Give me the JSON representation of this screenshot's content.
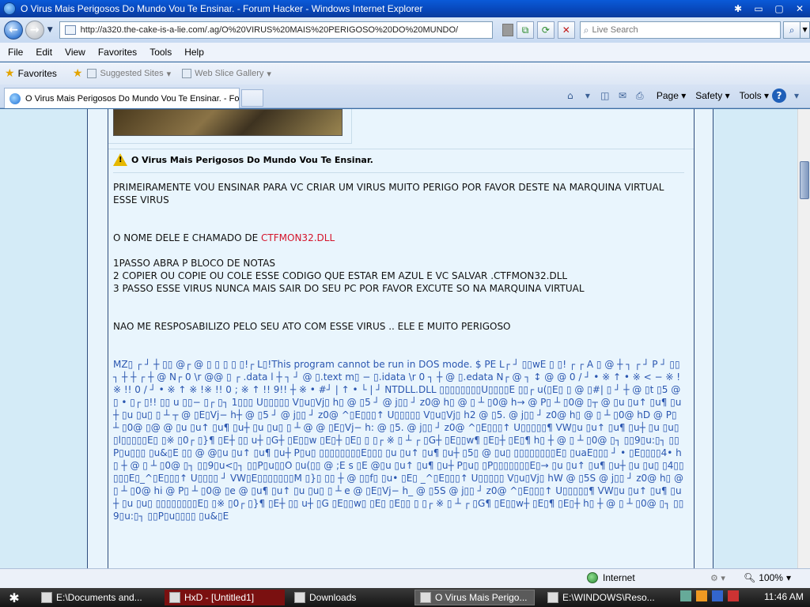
{
  "window": {
    "title": "O Virus Mais Perigosos Do Mundo Vou Te Ensinar. - Forum Hacker - Windows Internet Explorer"
  },
  "address_bar": {
    "url": "http://a320.the-cake-is-a-lie.com/.ag/O%20VIRUS%20MAIS%20PERIGOSO%20DO%20MUNDO/"
  },
  "search": {
    "placeholder": "Live Search"
  },
  "menu": [
    "File",
    "Edit",
    "View",
    "Favorites",
    "Tools",
    "Help"
  ],
  "favorites_bar": {
    "favorites_label": "Favorites",
    "suggested_sites": "Suggested Sites",
    "web_slice_gallery": "Web Slice Gallery"
  },
  "tabs": [
    {
      "label": "O Virus Mais Perigosos Do Mundo Vou Te Ensinar. - Fo..."
    }
  ],
  "command_bar": {
    "page": "Page",
    "safety": "Safety",
    "tools": "Tools"
  },
  "post": {
    "title": "O Virus Mais Perigosos Do Mundo Vou Te Ensinar.",
    "line1": "PRIMEIRAMENTE VOU ENSINAR PARA VC CRIAR UM VIRUS MUITO PERIGO POR FAVOR DESTE NA MARQUINA VIRTUAL ESSE VIRUS",
    "name_prefix": "O NOME DELE E CHAMADO DE ",
    "name_value": "CTFMON32.DLL",
    "step1": "1PASSO ABRA P BLOCO DE NOTAS",
    "step2": "2 COPIER OU COPIE OU COLE ESSE CODIGO QUE ESTAR EM AZUL E VC SALVAR .CTFMON32.DLL",
    "step3": "3 PASSO ESSE VIRUS NUNCA MAIS SAIR DO SEU PC POR FAVOR EXCUTE SO NA MARQUINA VIRTUAL",
    "disclaimer": "NAO ME RESPOSABILIZO PELO SEU ATO COM ESSE VIRUS .. ELE E MUITO PERIGOSO",
    "code": "MZ▯ ┌ ┘ ┼ ▯▯ @┌ @ ▯ ▯ ▯ ▯ ▯!┌ L▯!This program cannot be run in DOS mode. $ PE L┌ ┘ ▯▯wE ▯ ▯! ┌ ┌ A ▯ @ ┼ ┐ ┌ ┘ P ┘ ▯▯ ┐ ┼ ┼ ┌ ┼ @ N┌ 0 \\r @@ ▯ ┌ .data l ┼ ┐ ┘ @ ▯.text m▯ − ▯.idata \\r 0 ┐ ┼ @ ▯.edata N┌ @ ┐ ↕ @ @ 0 / ┘ • ※ ↑ • ※ < − ※ !※ !! 0 / ┘ • ※ ↑ ※ !※ !! 0 ; ※ ↑ !! 9!! ┼ ※ • #┘ | ↑ • └ | ┘ NTDLL.DLL ▯▯▯▯▯▯▯▯U▯▯▯▯E ▯▯┌ u(▯E▯ ▯ @ ▯#| ▯ ┘ ┼ @ ▯t ▯5 @ ▯ • ▯┌ ▯!! ▯▯ u ▯▯− ▯┌ ▯┐ 1▯▯▯ U▯▯▯▯▯ V▯u▯Vj▯ h▯ @ ▯5 ┘ @ j▯▯ ┘ z0@ h▯ @ ▯ ┴ ▯0@ h→ @ P▯ ┴ ▯0@ ▯┬ @ ▯u ▯u↑ ▯u¶ ▯u┼ ▯u ▯u▯ ▯ ┴ ┬ @ ▯E▯Vj− h┼ @ ▯5 ┘ @ j▯▯ ┘ z0@ ^▯E▯▯▯↑ U▯▯▯▯▯ V▯u▯Vj▯ h2 @ ▯5. @ j▯▯ ┘ z0@ h▯ @ ▯ ┴ ▯0@ hD @ P▯ ┴ ▯0@ ▯@ @ ▯u ▯u↑ ▯u¶ ▯u┼ ▯u ▯u▯ ▯ ┴ @ @ ▯E▯Vj− h: @ ▯5. @ j▯▯ ┘ z0@ ^▯E▯▯▯↑ U▯▯▯▯▯¶ VW▯u ▯u↑ ▯u¶ ▯u┼ ▯u ▯u▯ ▯l▯▯▯▯▯E▯ ▯※ ▯0┌ ▯}¶ ▯E┼ ▯▯ u┼ ▯G┼ ▯E▯▯w ▯E▯┼ ▯E▯ ▯ ▯┌ ※ ▯ ┴ ┌ ▯G┼ ▯E▯▯w¶ ▯E▯┼ ▯E▯¶ h▯ ┼ @ ▯ ┴ ▯0@ ▯┐ ▯▯9▯u:▯┐ ▯▯P▯u▯▯▯ ▯u&▯E ▯▯ @ @▯u ▯u↑ ▯u¶ ▯u┼ P▯u▯ ▯▯▯▯▯▯▯▯E▯▯▯ ▯u ▯u↑ ▯u¶ ▯u┼ ▯5▯ @ ▯u▯ ▯▯▯▯▯▯▯▯E▯ ▯uaE▯▯▯ ┘ • ▯E▯▯▯▯4• h▯ ┼ @ ▯ ┴ ▯0@ ▯┐ ▯▯9▯u<▯┐ ▯▯P▯u▯▯O ▯u(▯▯ @ ;E s ▯E @▯u ▯u↑ ▯u¶ ▯u┼ P▯u▯ ▯P▯▯▯▯▯▯▯E▯→ ▯u ▯u↑ ▯u¶ ▯u┼ ▯u ▯u▯ ▯4▯▯▯▯▯E▯_^▯E▯▯▯↑ U▯▯▯▯ ┘ VW▯E▯▯▯▯▯▯▯M ▯}▯ ▯▯ ┼ @ ▯▯f▯ ▯u• ▯E▯ _^▯E▯▯▯↑ U▯▯▯▯▯ V▯u▯Vj▯ hW @ ▯5S @ j▯▯ ┘ z0@ h▯ @ ▯ ┴ ▯0@ hi @ P▯ ┴ ▯0@ ▯e @ ▯u¶ ▯u↑ ▯u ▯u▯ ▯ ┴ e @ ▯E▯Vj− h_ @ ▯5S @ j▯▯ ┘ z0@ ^▯E▯▯▯↑ U▯▯▯▯▯¶ VW▯u ▯u↑ ▯u¶ ▯u┼ ▯u ▯u▯ ▯▯▯▯▯▯▯▯E▯ ▯※ ▯0┌ ▯}¶ ▯E┼ ▯▯ u┼ ▯G ▯E▯▯w▯ ▯E▯ ▯E▯▯ ▯ ▯┌ ※ ▯ ┴ ┌ ▯G¶ ▯E▯▯w┼ ▯E▯¶ ▯E▯┼ h▯ ┼ @ ▯ ┴ ▯0@ ▯┐ ▯▯9▯u:▯┐ ▯▯P▯u▯▯▯▯ ▯u&▯E"
  },
  "status_bar": {
    "zone": "Internet",
    "zoom": "100%"
  },
  "taskbar": {
    "items": [
      {
        "label": "E:\\Documents and..."
      },
      {
        "label": "HxD - [Untitled1]"
      },
      {
        "label": "Downloads"
      },
      {
        "label": "O Virus Mais Perigo..."
      },
      {
        "label": "E:\\WINDOWS\\Reso..."
      }
    ],
    "clock": "11:46 AM"
  }
}
